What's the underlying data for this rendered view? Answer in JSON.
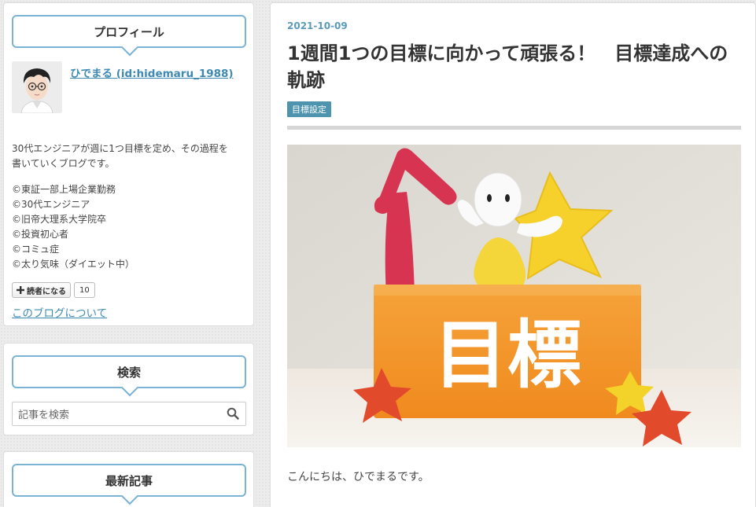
{
  "profile": {
    "heading": "プロフィール",
    "username": "ひでまる (id:hidemaru_1988)",
    "description": "30代エンジニアが週に1つ目標を定め、その過程を書いていくブログです。",
    "description_line1": "30代エンジニアが週に1つ目標を定め、その過程を",
    "description_line2": "書いていくブログです。",
    "facts": [
      "©東証一部上場企業勤務",
      "©30代エンジニア",
      "©旧帝大理系大学院卒",
      "©投資初心者",
      "©コミュ症",
      "©太り気味（ダイエット中）"
    ],
    "subscribe_label": "読者になる",
    "subscriber_count": "10",
    "about_link": "このブログについて"
  },
  "search": {
    "heading": "検索",
    "placeholder": "記事を検索"
  },
  "recent": {
    "heading": "最新記事"
  },
  "article": {
    "date": "2021-10-09",
    "title": "1週間1つの目標に向かって頑張る！　目標達成への軌跡",
    "category": "目標設定",
    "image_text": "目標",
    "greeting": "こんにちは、ひでまるです。"
  },
  "colors": {
    "accent": "#3d8ab4",
    "bubble_border": "#7ab3d4",
    "category_bg": "#4e94ae",
    "block_orange": "#f39a2c"
  }
}
